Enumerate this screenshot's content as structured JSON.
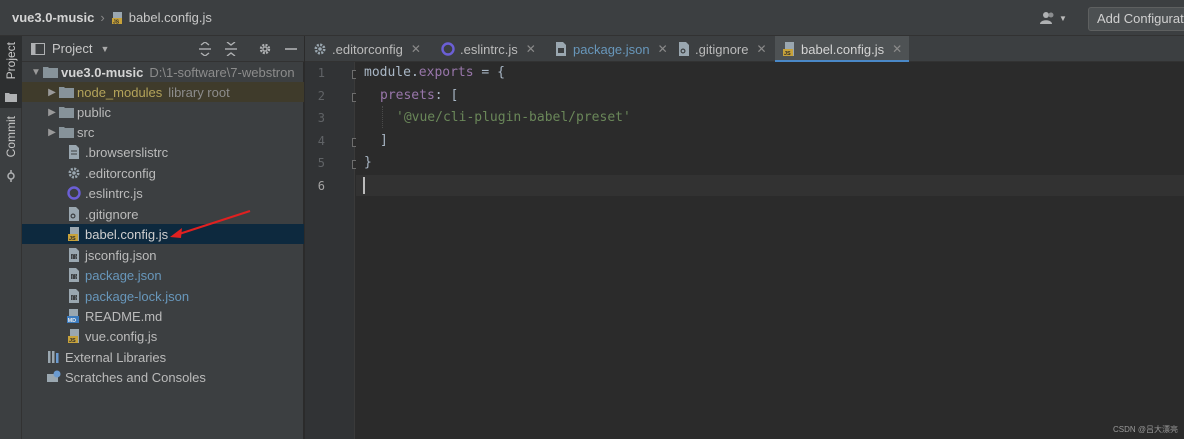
{
  "breadcrumb": {
    "project": "vue3.0-music",
    "file": "babel.config.js"
  },
  "toolbar": {
    "add_config_label": "Add Configurati"
  },
  "toolstrip": {
    "project_label": "Project",
    "commit_label": "Commit"
  },
  "project_panel": {
    "title": "Project",
    "tree": [
      {
        "name": "vue3.0-music",
        "hint": "D:\\1-software\\7-webstron",
        "icon": "folder-icon"
      },
      {
        "name": "node_modules",
        "hint": "library root",
        "icon": "folder-icon"
      },
      {
        "name": "public",
        "hint": "",
        "icon": "folder-icon"
      },
      {
        "name": "src",
        "hint": "",
        "icon": "folder-icon"
      },
      {
        "name": ".browserslistrc",
        "hint": "",
        "icon": "file-icon"
      },
      {
        "name": ".editorconfig",
        "hint": "",
        "icon": "gear-icon"
      },
      {
        "name": ".eslintrc.js",
        "hint": "",
        "icon": "eslint-icon"
      },
      {
        "name": ".gitignore",
        "hint": "",
        "icon": "gitignore-icon"
      },
      {
        "name": "babel.config.js",
        "hint": "",
        "icon": "js-file-icon"
      },
      {
        "name": "jsconfig.json",
        "hint": "",
        "icon": "json-file-icon"
      },
      {
        "name": "package.json",
        "hint": "",
        "icon": "json-file-icon"
      },
      {
        "name": "package-lock.json",
        "hint": "",
        "icon": "json-file-icon"
      },
      {
        "name": "README.md",
        "hint": "",
        "icon": "md-file-icon"
      },
      {
        "name": "vue.config.js",
        "hint": "",
        "icon": "js-file-icon"
      },
      {
        "name": "External Libraries",
        "hint": "",
        "icon": "libraries-icon"
      },
      {
        "name": "Scratches and Consoles",
        "hint": "",
        "icon": "scratches-icon"
      }
    ]
  },
  "tabs": [
    {
      "label": ".editorconfig",
      "icon": "gear-icon"
    },
    {
      "label": ".eslintrc.js",
      "icon": "eslint-icon"
    },
    {
      "label": "package.json",
      "icon": "json-file-icon"
    },
    {
      "label": ".gitignore",
      "icon": "gitignore-icon"
    },
    {
      "label": "babel.config.js",
      "icon": "js-file-icon"
    }
  ],
  "editor": {
    "line_numbers": [
      "1",
      "2",
      "3",
      "4",
      "5",
      "6"
    ],
    "code": {
      "l1_a": "module.",
      "l1_b": "exports",
      "l1_c": " = {",
      "l2_a": "presets",
      "l2_b": ": [",
      "l3": "'@vue/cli-plugin-babel/preset'",
      "l4": "]",
      "l5": "}"
    }
  },
  "watermark": "CSDN @吕大漂亮",
  "colors": {
    "selected_row": "#0d293e",
    "tab_underline": "#4a88c7",
    "annotation_arrow": "#e02020"
  }
}
